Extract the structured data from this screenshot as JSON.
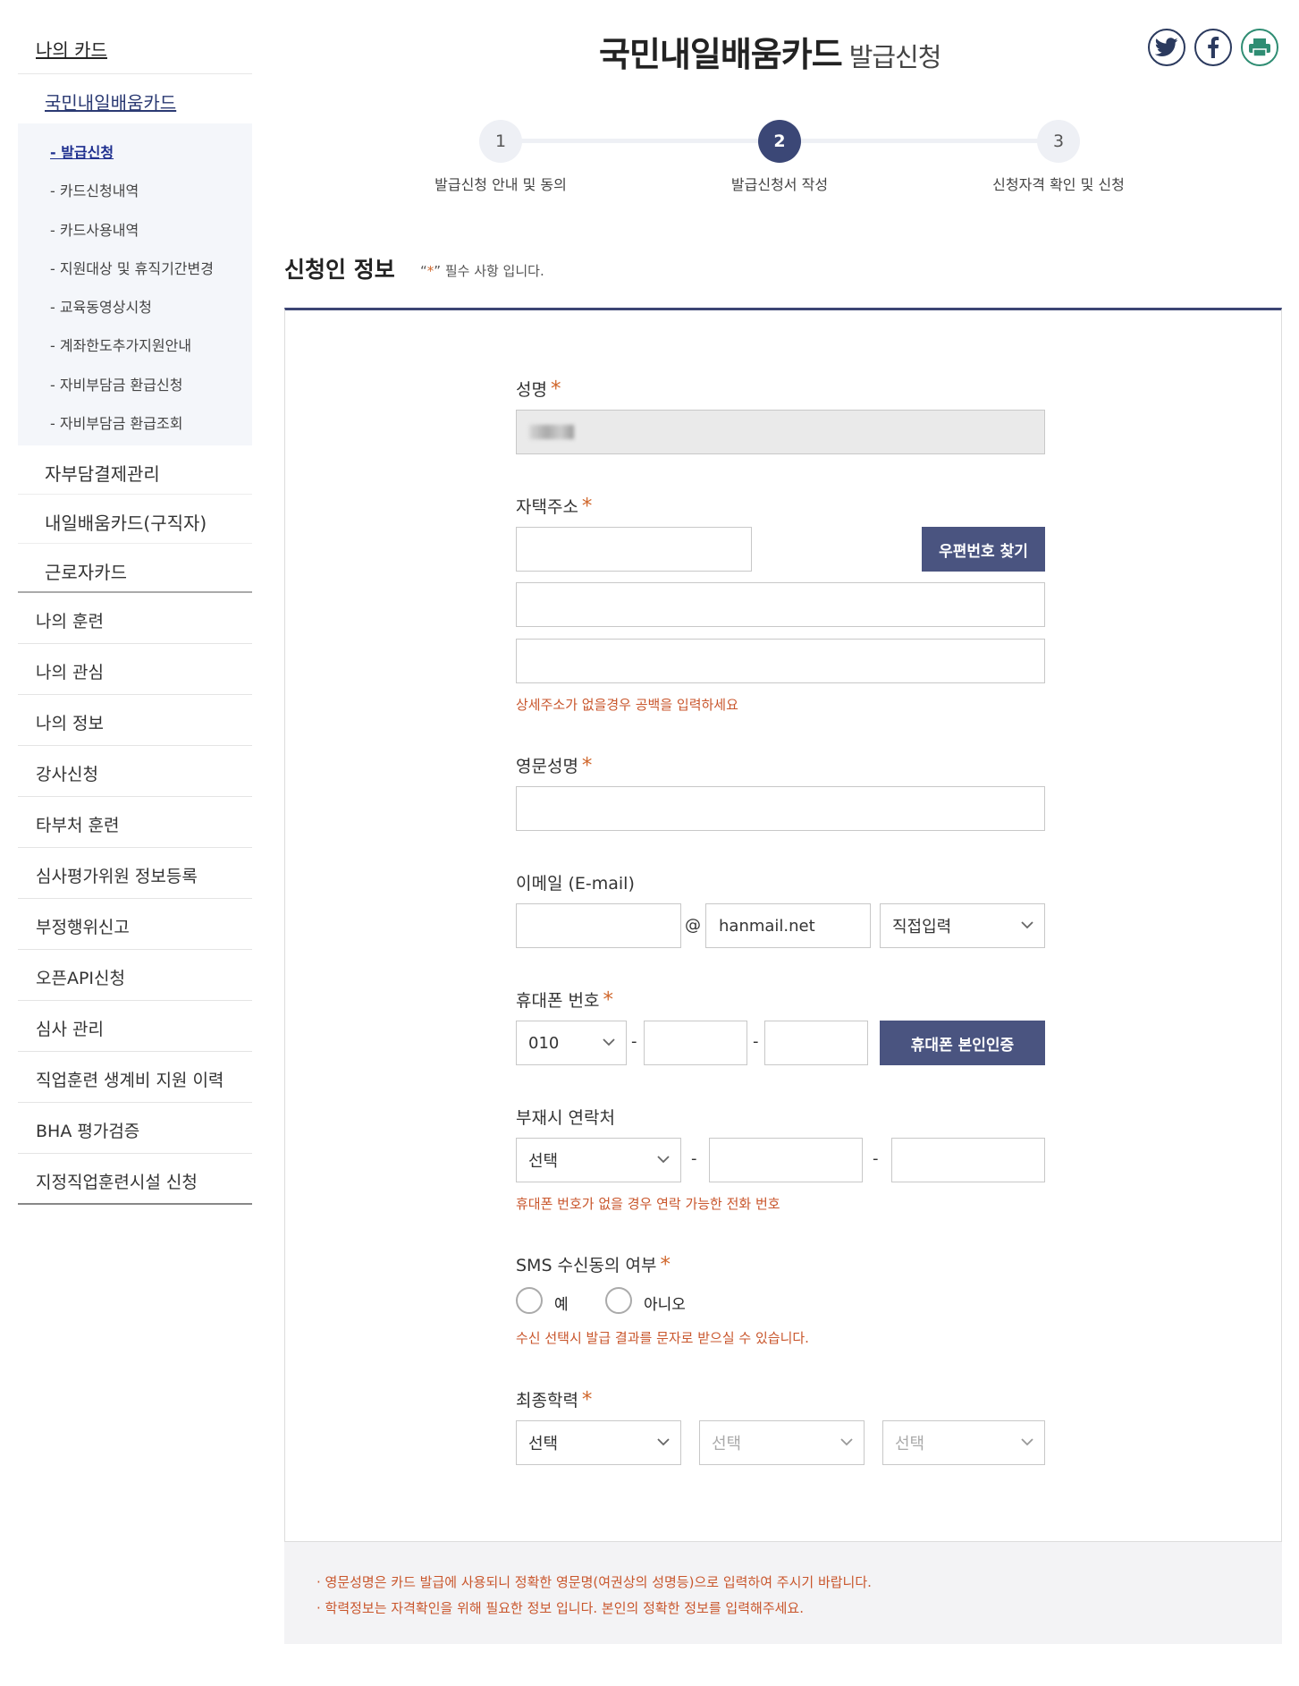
{
  "sidebar": {
    "top": "나의 카드",
    "section": "국민내일배움카드",
    "sub_items": [
      "- 발급신청",
      "- 카드신청내역",
      "- 카드사용내역",
      "- 지원대상 및 휴직기간변경",
      "- 교육동영상시청",
      "- 계좌한도추가지원안내",
      "- 자비부담금 환급신청",
      "- 자비부담금 환급조회"
    ],
    "section_items": [
      "자부담결제관리",
      "내일배움카드(구직자)",
      "근로자카드"
    ],
    "menu": [
      "나의 훈련",
      "나의 관심",
      "나의 정보",
      "강사신청",
      "타부처 훈련",
      "심사평가위원 정보등록",
      "부정행위신고",
      "오픈API신청",
      "심사 관리",
      "직업훈련 생계비 지원 이력",
      "BHA 평가검증",
      "지정직업훈련시설 신청"
    ]
  },
  "header": {
    "title": "국민내일배움카드",
    "subtitle": "발급신청",
    "share_icons": [
      "twitter-icon",
      "facebook-icon",
      "print-icon"
    ]
  },
  "steps": [
    {
      "num": "1",
      "label": "발급신청 안내 및 동의"
    },
    {
      "num": "2",
      "label": "발급신청서 작성"
    },
    {
      "num": "3",
      "label": "신청자격 확인 및 신청"
    }
  ],
  "section": {
    "title": "신청인 정보",
    "note_open": "“",
    "note_star": "*",
    "note_rest": "” 필수 사항 입니다."
  },
  "form": {
    "star": "*",
    "name_label": "성명",
    "address_label": "자택주소",
    "zip_button": "우편번호 찾기",
    "address_hint": "상세주소가 없을경우 공백을 입력하세요",
    "eng_name_label": "영문성명",
    "email_label": "이메일 (E-mail)",
    "email_at": "@",
    "email_domain": "hanmail.net",
    "email_select": "직접입력",
    "phone_label": "휴대폰 번호",
    "phone_prefix": "010",
    "dash": "-",
    "phone_button": "휴대폰 본인인증",
    "alt_label": "부재시 연락처",
    "alt_select": "선택",
    "alt_hint": "휴대폰 번호가 없을 경우 연락 가능한 전화 번호",
    "sms_label": "SMS 수신동의 여부",
    "sms_yes": "예",
    "sms_no": "아니오",
    "sms_hint": "수신 선택시 발급 결과를 문자로 받으실 수 있습니다.",
    "edu_label": "최종학력",
    "edu_select_1": "선택",
    "edu_select_2": "선택",
    "edu_select_3": "선택"
  },
  "notice": [
    "· 영문성명은 카드 발급에 사용되니 정확한 영문명(여권상의 성명등)으로 입력하여 주시기 바랍니다.",
    "· 학력정보는 자격확인을 위해 필요한 정보 입니다. 본인의 정확한 정보를 입력해주세요."
  ],
  "colors": {
    "accent": "#3b4776",
    "warning": "#c9562c",
    "button": "#4a5480",
    "print": "#2f8d73"
  }
}
